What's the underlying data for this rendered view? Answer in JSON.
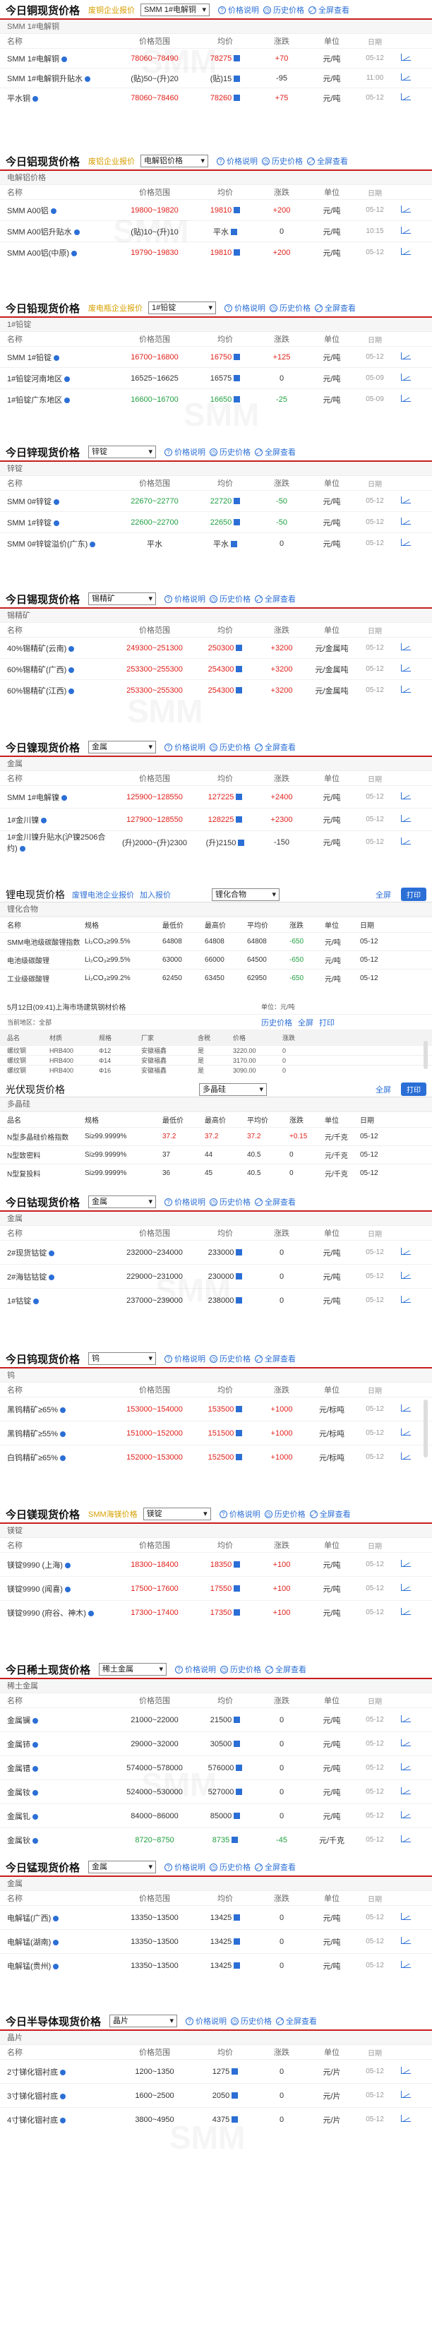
{
  "common": {
    "price_note": "价格说明",
    "history": "历史价格",
    "fullscreen": "全屏查看",
    "cols": [
      "名称",
      "价格范围",
      "均价",
      "涨跌",
      "单位",
      "日期"
    ],
    "unit_yuan_ton": "元/吨",
    "enterprise": "废铜企业报价",
    "waste_al": "废铝企业报价",
    "waste_elec": "废电瓶企业报价",
    "smm_ni_quote": "SMM海镁价格"
  },
  "copper": {
    "title": "今日铜现货价格",
    "select": "SMM 1#电解铜",
    "sub": "SMM 1#电解铜",
    "rows": [
      {
        "name": "SMM 1#电解铜",
        "range": "78060~78490",
        "avg": "78275",
        "chg": "+70",
        "unit": "元/吨",
        "date": "05-12",
        "cls": "up"
      },
      {
        "name": "SMM 1#电解铜升贴水",
        "range": "(贴)50~(升)20",
        "avg": "(贴)15",
        "chg": "-95",
        "unit": "元/吨",
        "date": "11:00",
        "cls": "flat"
      },
      {
        "name": "平水铜",
        "range": "78060~78460",
        "avg": "78260",
        "chg": "+75",
        "unit": "元/吨",
        "date": "05-12",
        "cls": "up"
      }
    ]
  },
  "aluminum": {
    "title": "今日铝现货价格",
    "select": "电解铝价格",
    "sub": "电解铝价格",
    "rows": [
      {
        "name": "SMM A00铝",
        "range": "19800~19820",
        "avg": "19810",
        "chg": "+200",
        "unit": "元/吨",
        "date": "05-12",
        "cls": "up"
      },
      {
        "name": "SMM A00铝升贴水",
        "range": "(贴)10~(升)10",
        "avg": "平水",
        "chg": "0",
        "unit": "元/吨",
        "date": "10:15",
        "cls": "flat"
      },
      {
        "name": "SMM A00铝(中原)",
        "range": "19790~19830",
        "avg": "19810",
        "chg": "+200",
        "unit": "元/吨",
        "date": "05-12",
        "cls": "up"
      }
    ]
  },
  "lead": {
    "title": "今日铅现货价格",
    "select": "1#铅锭",
    "sub": "1#铅锭",
    "rows": [
      {
        "name": "SMM 1#铅锭",
        "range": "16700~16800",
        "avg": "16750",
        "chg": "+125",
        "unit": "元/吨",
        "date": "05-12",
        "cls": "up"
      },
      {
        "name": "1#铅锭河南地区",
        "range": "16525~16625",
        "avg": "16575",
        "chg": "0",
        "unit": "元/吨",
        "date": "05-09",
        "cls": "flat"
      },
      {
        "name": "1#铅锭广东地区",
        "range": "16600~16700",
        "avg": "16650",
        "chg": "-25",
        "unit": "元/吨",
        "date": "05-09",
        "cls": "down"
      }
    ]
  },
  "zinc": {
    "title": "今日锌现货价格",
    "select": "锌锭",
    "sub": "锌锭",
    "rows": [
      {
        "name": "SMM 0#锌锭",
        "range": "22670~22770",
        "avg": "22720",
        "chg": "-50",
        "unit": "元/吨",
        "date": "05-12",
        "cls": "down"
      },
      {
        "name": "SMM 1#锌锭",
        "range": "22600~22700",
        "avg": "22650",
        "chg": "-50",
        "unit": "元/吨",
        "date": "05-12",
        "cls": "down"
      },
      {
        "name": "SMM 0#锌锭溢价(广东)",
        "range": "平水",
        "avg": "平水",
        "chg": "0",
        "unit": "元/吨",
        "date": "05-12",
        "cls": "flat"
      }
    ]
  },
  "tin": {
    "title": "今日锡现货价格",
    "select": "锡精矿",
    "sub": "锡精矿",
    "rows": [
      {
        "name": "40%锡精矿(云南)",
        "range": "249300~251300",
        "avg": "250300",
        "chg": "+3200",
        "unit": "元/金属吨",
        "date": "05-12",
        "cls": "up"
      },
      {
        "name": "60%锡精矿(广西)",
        "range": "253300~255300",
        "avg": "254300",
        "chg": "+3200",
        "unit": "元/金属吨",
        "date": "05-12",
        "cls": "up"
      },
      {
        "name": "60%锡精矿(江西)",
        "range": "253300~255300",
        "avg": "254300",
        "chg": "+3200",
        "unit": "元/金属吨",
        "date": "05-12",
        "cls": "up"
      }
    ]
  },
  "nickel": {
    "title": "今日镍现货价格",
    "select": "金属",
    "sub": "金属",
    "rows": [
      {
        "name": "SMM 1#电解镍",
        "range": "125900~128550",
        "avg": "127225",
        "chg": "+2400",
        "unit": "元/吨",
        "date": "05-12",
        "cls": "up"
      },
      {
        "name": "1#金川镍",
        "range": "127900~128550",
        "avg": "128225",
        "chg": "+2300",
        "unit": "元/吨",
        "date": "05-12",
        "cls": "up"
      },
      {
        "name": "1#金川镍升贴水(沪镍2506合约)",
        "range": "(升)2000~(升)2300",
        "avg": "(升)2150",
        "chg": "-150",
        "unit": "元/吨",
        "date": "05-12",
        "cls": "flat"
      }
    ]
  },
  "lithium": {
    "title": "锂电现货价格",
    "links": [
      "废锂电池企业报价",
      "加入报价"
    ],
    "select": "锂化合物",
    "fs": "全屏",
    "print": "打印",
    "sub": "锂化合物",
    "cols": [
      "名称",
      "规格",
      "最低价",
      "最高价",
      "平均价",
      "涨跌",
      "单位",
      "日期"
    ],
    "rows": [
      {
        "name": "SMM电池级碳酸锂指数",
        "spec": "Li₂CO₃≥99.5%",
        "low": "64808",
        "high": "64808",
        "avg": "64808",
        "chg": "-650",
        "unit": "元/吨",
        "date": "05-12"
      },
      {
        "name": "电池级碳酸锂",
        "spec": "Li₂CO₃≥99.5%",
        "low": "63000",
        "high": "66000",
        "avg": "64500",
        "chg": "-650",
        "unit": "元/吨",
        "date": "05-12"
      },
      {
        "name": "工业级碳酸锂",
        "spec": "Li₂CO₃≥99.2%",
        "low": "62450",
        "high": "63450",
        "avg": "62950",
        "chg": "-650",
        "unit": "元/吨",
        "date": "05-12"
      }
    ]
  },
  "steel": {
    "title": "5月12日(09:41)上海市场建筑钢材价格",
    "unit": "单位：元/吨",
    "region": "当前地区：全部",
    "cols": [
      "品名",
      "材质",
      "规格",
      "厂家",
      "含税",
      "价格",
      "涨跌"
    ],
    "tools": [
      "历史价格",
      "全屏",
      "打印"
    ],
    "rows": [
      {
        "name": "螺纹钢",
        "mat": "HRB400",
        "spec": "Φ12",
        "maker": "安徽福鑫",
        "tax": "是",
        "price": "3220.00",
        "chg": "0"
      },
      {
        "name": "螺纹钢",
        "mat": "HRB400",
        "spec": "Φ14",
        "maker": "安徽福鑫",
        "tax": "是",
        "price": "3170.00",
        "chg": "0"
      },
      {
        "name": "螺纹钢",
        "mat": "HRB400",
        "spec": "Φ16",
        "maker": "安徽福鑫",
        "tax": "是",
        "price": "3090.00",
        "chg": "0"
      }
    ]
  },
  "pv": {
    "title": "光伏现货价格",
    "select": "多晶硅",
    "fs": "全屏",
    "print": "打印",
    "sub": "多晶硅",
    "cols": [
      "品名",
      "规格",
      "最低价",
      "最高价",
      "平均价",
      "涨跌",
      "单位",
      "日期"
    ],
    "rows": [
      {
        "name": "N型多晶硅价格指数",
        "spec": "Si≥99.9999%",
        "low": "37.2",
        "high": "37.2",
        "avg": "37.2",
        "chg": "+0.15",
        "unit": "元/千克",
        "date": "05-12"
      },
      {
        "name": "N型致密料",
        "spec": "Si≥99.9999%",
        "low": "37",
        "high": "44",
        "avg": "40.5",
        "chg": "0",
        "unit": "元/千克",
        "date": "05-12"
      },
      {
        "name": "N型复投料",
        "spec": "Si≥99.9999%",
        "low": "36",
        "high": "45",
        "avg": "40.5",
        "chg": "0",
        "unit": "元/千克",
        "date": "05-12"
      }
    ]
  },
  "cobalt": {
    "title": "今日钴现货价格",
    "select": "金属",
    "sub": "金属",
    "rows": [
      {
        "name": "2#现货钴锭",
        "range": "232000~234000",
        "avg": "233000",
        "chg": "0",
        "unit": "元/吨",
        "date": "05-12",
        "cls": "flat"
      },
      {
        "name": "2#海钴钴锭",
        "range": "229000~231000",
        "avg": "230000",
        "chg": "0",
        "unit": "元/吨",
        "date": "05-12",
        "cls": "flat"
      },
      {
        "name": "1#钴锭",
        "range": "237000~239000",
        "avg": "238000",
        "chg": "0",
        "unit": "元/吨",
        "date": "05-12",
        "cls": "flat"
      }
    ]
  },
  "tungsten": {
    "title": "今日钨现货价格",
    "select": "钨",
    "sub": "钨",
    "rows": [
      {
        "name": "黑钨精矿≥65%",
        "range": "153000~154000",
        "avg": "153500",
        "chg": "+1000",
        "unit": "元/标吨",
        "date": "05-12",
        "cls": "up"
      },
      {
        "name": "黑钨精矿≥55%",
        "range": "151000~152000",
        "avg": "151500",
        "chg": "+1000",
        "unit": "元/标吨",
        "date": "05-12",
        "cls": "up"
      },
      {
        "name": "白钨精矿≥65%",
        "range": "152000~153000",
        "avg": "152500",
        "chg": "+1000",
        "unit": "元/标吨",
        "date": "05-12",
        "cls": "up"
      }
    ]
  },
  "magnesium": {
    "title": "今日镁现货价格",
    "select": "镁锭",
    "sub": "镁锭",
    "rows": [
      {
        "name": "镁锭9990 (上海)",
        "range": "18300~18400",
        "avg": "18350",
        "chg": "+100",
        "unit": "元/吨",
        "date": "05-12",
        "cls": "up"
      },
      {
        "name": "镁锭9990 (闻喜)",
        "range": "17500~17600",
        "avg": "17550",
        "chg": "+100",
        "unit": "元/吨",
        "date": "05-12",
        "cls": "up"
      },
      {
        "name": "镁锭9990 (府谷、神木)",
        "range": "17300~17400",
        "avg": "17350",
        "chg": "+100",
        "unit": "元/吨",
        "date": "05-12",
        "cls": "up"
      }
    ]
  },
  "rare": {
    "title": "今日稀土现货价格",
    "select": "稀土金属",
    "sub": "稀土金属",
    "rows": [
      {
        "name": "金属镧",
        "range": "21000~22000",
        "avg": "21500",
        "chg": "0",
        "unit": "元/吨",
        "date": "05-12",
        "cls": "flat"
      },
      {
        "name": "金属铈",
        "range": "29000~32000",
        "avg": "30500",
        "chg": "0",
        "unit": "元/吨",
        "date": "05-12",
        "cls": "flat"
      },
      {
        "name": "金属镨",
        "range": "574000~578000",
        "avg": "576000",
        "chg": "0",
        "unit": "元/吨",
        "date": "05-12",
        "cls": "flat"
      },
      {
        "name": "金属钕",
        "range": "524000~530000",
        "avg": "527000",
        "chg": "0",
        "unit": "元/吨",
        "date": "05-12",
        "cls": "flat"
      },
      {
        "name": "金属钆",
        "range": "84000~86000",
        "avg": "85000",
        "chg": "0",
        "unit": "元/吨",
        "date": "05-12",
        "cls": "flat"
      },
      {
        "name": "金属钬",
        "range": "8720~8750",
        "avg": "8735",
        "chg": "-45",
        "unit": "元/千克",
        "date": "05-12",
        "cls": "down"
      }
    ]
  },
  "manganese": {
    "title": "今日锰现货价格",
    "select": "金属",
    "sub": "金属",
    "rows": [
      {
        "name": "电解锰(广西)",
        "range": "13350~13500",
        "avg": "13425",
        "chg": "0",
        "unit": "元/吨",
        "date": "05-12",
        "cls": "flat"
      },
      {
        "name": "电解锰(湖南)",
        "range": "13350~13500",
        "avg": "13425",
        "chg": "0",
        "unit": "元/吨",
        "date": "05-12",
        "cls": "flat"
      },
      {
        "name": "电解锰(贵州)",
        "range": "13350~13500",
        "avg": "13425",
        "chg": "0",
        "unit": "元/吨",
        "date": "05-12",
        "cls": "flat"
      }
    ]
  },
  "semi": {
    "title": "今日半导体现货价格",
    "select": "晶片",
    "sub": "晶片",
    "rows": [
      {
        "name": "2寸锑化铟衬底",
        "range": "1200~1350",
        "avg": "1275",
        "chg": "0",
        "unit": "元/片",
        "date": "05-12",
        "cls": "flat"
      },
      {
        "name": "3寸锑化铟衬底",
        "range": "1600~2500",
        "avg": "2050",
        "chg": "0",
        "unit": "元/片",
        "date": "05-12",
        "cls": "flat"
      },
      {
        "name": "4寸锑化铟衬底",
        "range": "3800~4950",
        "avg": "4375",
        "chg": "0",
        "unit": "元/片",
        "date": "05-12",
        "cls": "flat"
      }
    ]
  },
  "watermark": "SMM"
}
